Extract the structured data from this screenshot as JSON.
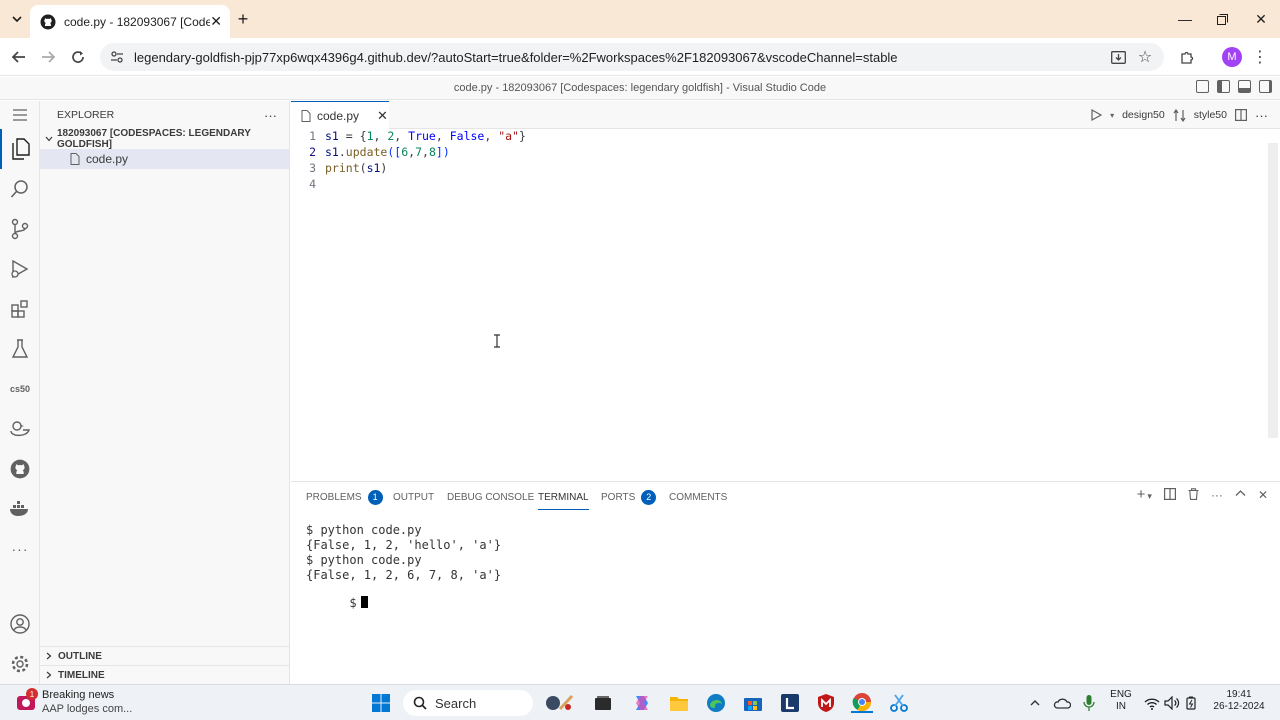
{
  "browser": {
    "tab_title": "code.py - 182093067 [Codespaces",
    "new_tab": "+",
    "url": "legendary-goldfish-pjp77xp6wqx4396g4.github.dev/?autoStart=true&folder=%2Fworkspaces%2F182093067&vscodeChannel=stable",
    "profile_initial": "M",
    "window_controls": [
      "minimize",
      "maximize",
      "close"
    ]
  },
  "vscode": {
    "title": "code.py - 182093067 [Codespaces: legendary goldfish] - Visual Studio Code"
  },
  "sidebar": {
    "header": "EXPLORER",
    "more": "···",
    "folder": "182093067 [CODESPACES: LEGENDARY GOLDFISH]",
    "file": "code.py",
    "outline": "OUTLINE",
    "timeline": "TIMELINE"
  },
  "activity_bar": {
    "items": [
      "explorer-icon",
      "search-icon",
      "source-control-icon",
      "run-debug-icon",
      "extensions-icon",
      "testing-icon",
      "cs50-icon",
      "duck-icon",
      "github-icon",
      "docker-icon",
      "more-icon",
      "accounts-icon",
      "manage-icon"
    ],
    "cs50_label": "cs50",
    "more_label": "···"
  },
  "editor": {
    "tab_label": "code.py",
    "actions": {
      "design": "design50",
      "style": "style50"
    },
    "line_numbers": [
      "1",
      "2",
      "3",
      "4"
    ],
    "lines": [
      [
        "s1",
        " = {",
        "1",
        ", ",
        "2",
        ", ",
        "True",
        ", ",
        "False",
        ", ",
        "\"a\"",
        "}"
      ],
      [
        "s1",
        ".",
        "update",
        "([",
        "6",
        ",",
        "7",
        ",",
        "8",
        "])"
      ],
      [
        "print",
        "(",
        "s1",
        ")"
      ]
    ]
  },
  "panel": {
    "tabs": {
      "problems": "PROBLEMS",
      "problems_count": "1",
      "output": "OUTPUT",
      "debug": "DEBUG CONSOLE",
      "terminal": "TERMINAL",
      "ports": "PORTS",
      "ports_count": "2",
      "comments": "COMMENTS"
    },
    "terminal_lines": [
      "$ python code.py",
      "{False, 1, 2, 'hello', 'a'}",
      "$ python code.py",
      "{False, 1, 2, 6, 7, 8, 'a'}",
      "$"
    ]
  },
  "taskbar": {
    "news_title": "Breaking news",
    "news_sub": "AAP lodges com...",
    "news_badge": "1",
    "search": "Search",
    "lang_top": "ENG",
    "lang_bottom": "IN",
    "time": "19:41",
    "date": "26-12-2024"
  },
  "colors": {
    "accent": "#005fb8",
    "tab_strip": "#f9e8d6",
    "profile": "#a142f4"
  }
}
